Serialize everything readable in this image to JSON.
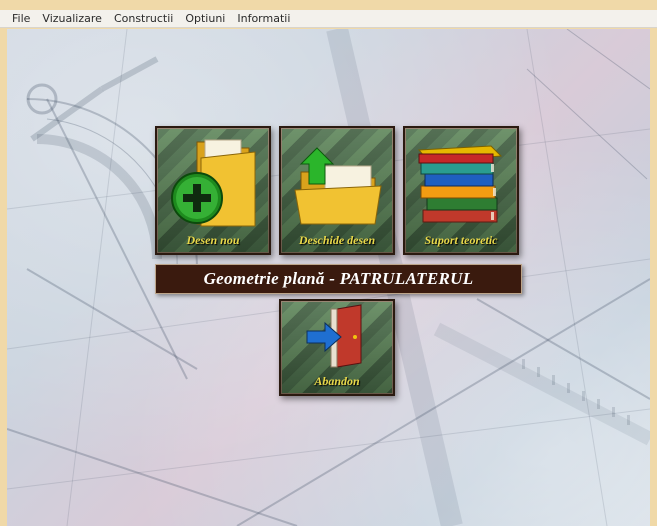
{
  "menu": {
    "file": "File",
    "view": "Vizualizare",
    "constructions": "Constructii",
    "options": "Optiuni",
    "info": "Informatii"
  },
  "tiles": {
    "new_drawing": {
      "label": "Desen nou",
      "icon": "folder-add-icon"
    },
    "open_drawing": {
      "label": "Deschide desen",
      "icon": "folder-open-icon"
    },
    "theory": {
      "label": "Suport teoretic",
      "icon": "books-icon"
    },
    "quit": {
      "label": "Abandon",
      "icon": "exit-door-icon"
    }
  },
  "banner": {
    "title": "Geometrie plană - PATRULATERUL"
  },
  "colors": {
    "tile_label": "#e8d84a",
    "banner_bg": "#3a1a0e",
    "tile_bg": "#4a6e4a"
  }
}
